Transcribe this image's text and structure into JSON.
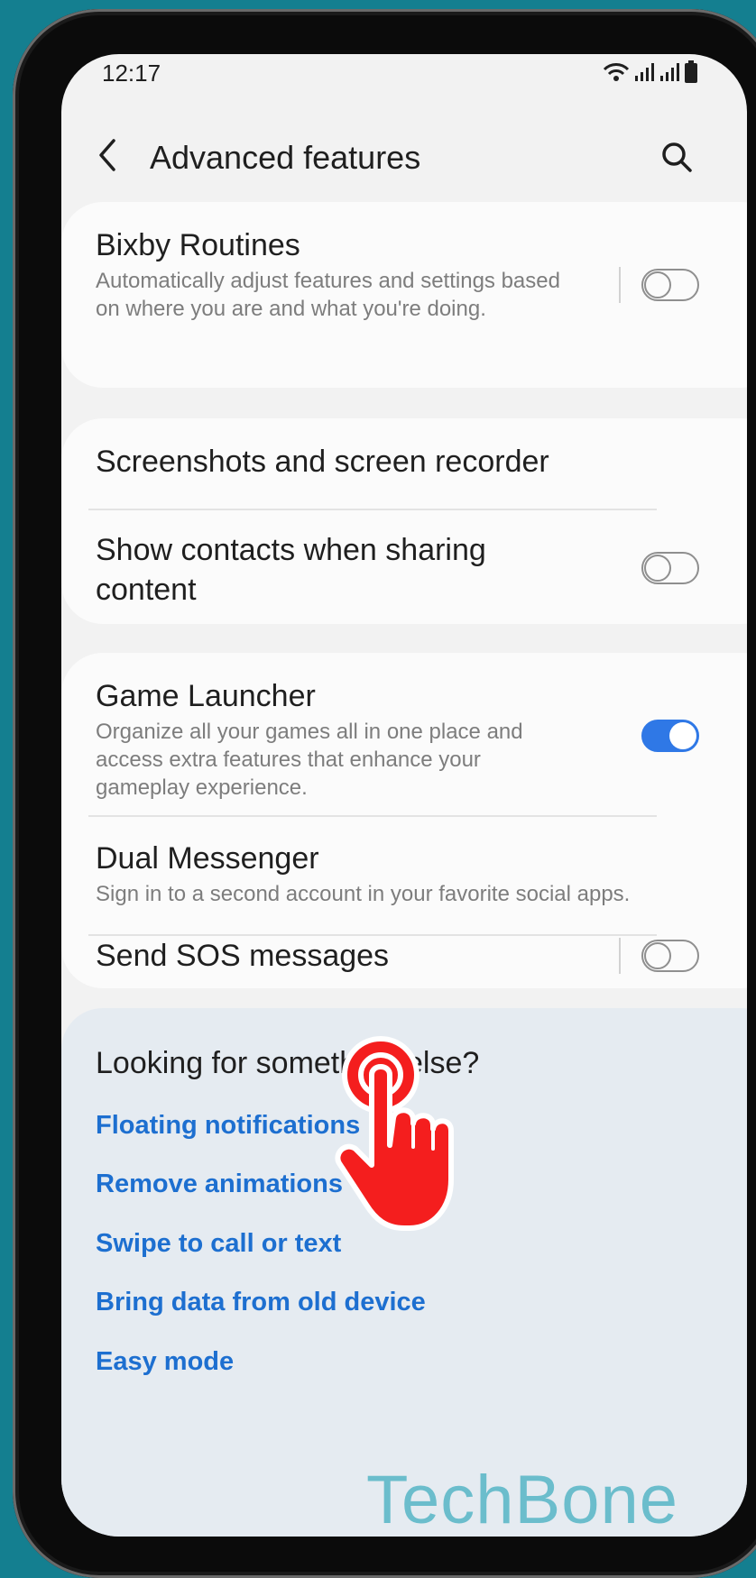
{
  "status_bar": {
    "time": "12:17",
    "icons": [
      "wifi-icon",
      "signal-icon",
      "signal-icon",
      "battery-icon"
    ]
  },
  "header": {
    "back_icon": "chevron-left-icon",
    "title": "Advanced features",
    "search_icon": "search-icon"
  },
  "cards": [
    {
      "rows": [
        {
          "title": "Bixby Routines",
          "subtitle": "Automatically adjust features and settings based on where you are and what you're doing.",
          "toggle": false,
          "has_separator": true
        }
      ]
    },
    {
      "rows": [
        {
          "title": "Screenshots and screen recorder"
        },
        {
          "title": "Show contacts when sharing content",
          "toggle": false
        }
      ]
    },
    {
      "rows": [
        {
          "title": "Game Launcher",
          "subtitle": "Organize all your games all in one place and access extra features that enhance your gameplay experience.",
          "toggle": true
        },
        {
          "title": "Dual Messenger",
          "subtitle": "Sign in to a second account in your favorite social apps."
        },
        {
          "title": "Send SOS messages",
          "toggle": false,
          "has_separator": true
        }
      ]
    }
  ],
  "suggestions": {
    "title": "Looking for something else?",
    "links": [
      "Floating notifications",
      "Remove animations",
      "Swipe to call or text",
      "Bring data from old device",
      "Easy mode"
    ]
  },
  "overlay": {
    "hand_icon": "tap-hand-icon",
    "watermark": "TechBone"
  },
  "colors": {
    "accent": "#2f78e6",
    "link": "#1d6fd0",
    "background": "#147f90",
    "hand": "#f41e1e"
  }
}
